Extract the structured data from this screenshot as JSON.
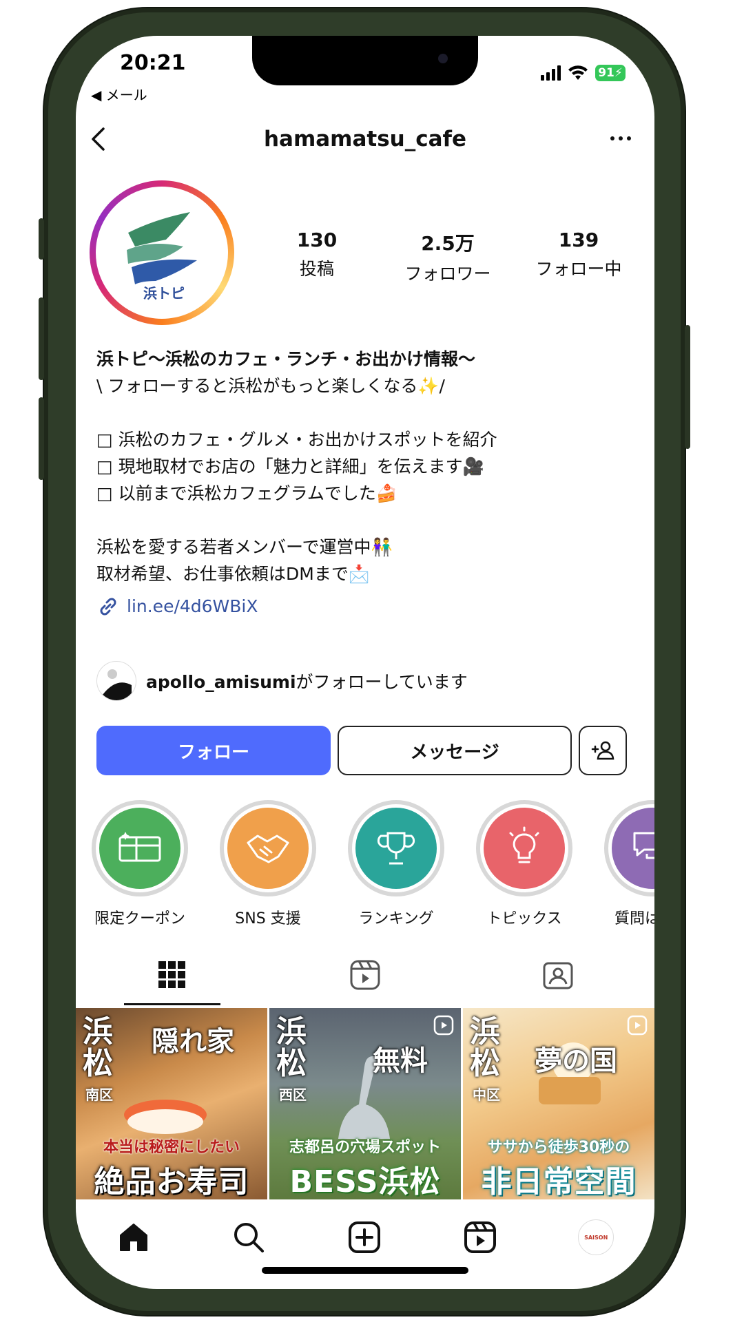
{
  "status_bar": {
    "time": "20:21",
    "back_app": "◀ メール",
    "battery": "91⚡"
  },
  "header": {
    "username": "hamamatsu_cafe"
  },
  "profile": {
    "avatar_text": "浜トピ",
    "stats": [
      {
        "value": "130",
        "label": "投稿"
      },
      {
        "value": "2.5万",
        "label": "フォロワー"
      },
      {
        "value": "139",
        "label": "フォロー中"
      }
    ]
  },
  "bio": {
    "name": "浜トピ〜浜松のカフェ・ランチ・お出かけ情報〜",
    "lines": [
      "\\ フォローすると浜松がもっと楽しくなる✨/",
      "",
      "□ 浜松のカフェ・グルメ・お出かけスポットを紹介",
      "□ 現地取材でお店の「魅力と詳細」を伝えます🎥",
      "□ 以前まで浜松カフェグラムでした🍰",
      "",
      "浜松を愛する若者メンバーで運営中👫",
      "取材希望、お仕事依頼はDMまで📩"
    ],
    "link": "lin.ee/4d6WBiX"
  },
  "mutual": {
    "user": "apollo_amisumi",
    "text": "がフォローしています"
  },
  "actions": {
    "follow": "フォロー",
    "message": "メッセージ"
  },
  "highlights": [
    {
      "label": "限定クーポン",
      "color": "#4caf5c"
    },
    {
      "label": "SNS 支援",
      "color": "#f0a04b"
    },
    {
      "label": "ランキング",
      "color": "#2aa59a"
    },
    {
      "label": "トピックス",
      "color": "#e8646a"
    },
    {
      "label": "質問はこち",
      "color": "#8e6bb4"
    }
  ],
  "posts": [
    {
      "area": "浜\n松",
      "ward": "南区",
      "tag": "隠れ家",
      "line1": "本当は秘密にしたい",
      "line2": "絶品お寿司"
    },
    {
      "area": "浜\n松",
      "ward": "西区",
      "tag": "無料",
      "line1": "志都呂の穴場スポット",
      "line2": "BESS浜松"
    },
    {
      "area": "浜\n松",
      "ward": "中区",
      "tag": "夢の国",
      "line1": "ササから徒歩30秒の",
      "line2": "非日常空間"
    }
  ],
  "nav_avatar": "SAISON"
}
